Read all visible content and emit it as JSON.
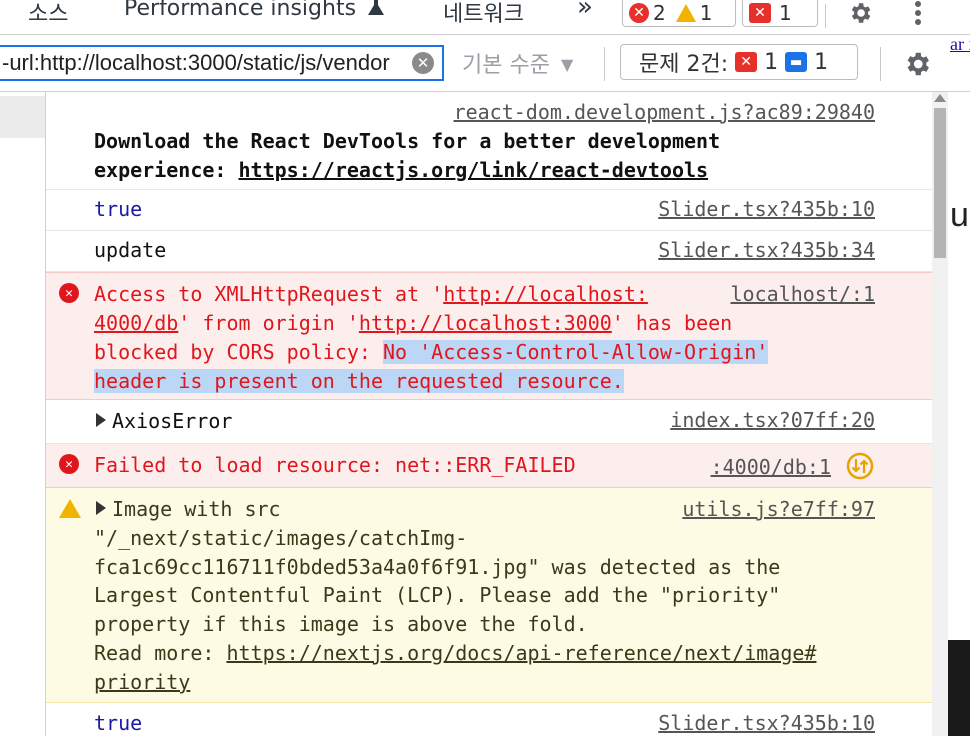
{
  "tabs": {
    "sources": "소스",
    "performance_insights": "Performance insights",
    "network": "네트워크",
    "more": "»"
  },
  "counters": {
    "errors": "2",
    "warnings": "1",
    "issues": "1"
  },
  "toolbar": {
    "filter_value": "-url:http://localhost:3000/static/js/vendor",
    "levels": "기본 수준",
    "issues_label": "문제 2건:",
    "issues_errors": "1",
    "issues_messages": "1"
  },
  "right_edge": {
    "link_fragment": "ar i",
    "letter": "u"
  },
  "console": {
    "msg1": {
      "source": "react-dom.development.js?ac89:29840",
      "line1": "Download the React DevTools for a better development",
      "line2_prefix": "experience: ",
      "line2_link": "https://reactjs.org/link/react-devtools"
    },
    "msg2": {
      "text": "true",
      "source": "Slider.tsx?435b:10"
    },
    "msg3": {
      "text": "update",
      "source": "Slider.tsx?435b:34"
    },
    "msg4": {
      "source": "localhost/:1",
      "l1_pre": "Access to XMLHttpRequest at '",
      "l1_link": "http://localhost:",
      "l2_link": "4000/db",
      "l2_mid": "' from origin '",
      "l2_link2": "http://localhost:3000",
      "l2_post": "' has been",
      "l3_pre": "blocked by CORS policy: ",
      "l3_hl": "No 'Access-Control-Allow-Origin'",
      "l4_hl": "header is present on the requested resource."
    },
    "msg5": {
      "text": "AxiosError",
      "source": "index.tsx?07ff:20"
    },
    "msg6": {
      "text": "Failed to load resource: net::ERR_FAILED",
      "source": ":4000/db:1"
    },
    "msg7": {
      "source": "utils.js?e7ff:97",
      "l1": "Image with src",
      "l2": "\"/_next/static/images/catchImg-",
      "l3": "fca1c69cc116711f0bded53a4a0f6f91.jpg\" was detected as the",
      "l4": "Largest Contentful Paint (LCP). Please add the \"priority\"",
      "l5": "property if this image is above the fold.",
      "l6_pre": "Read more: ",
      "l6_link": "https://nextjs.org/docs/api-reference/next/image#",
      "l7_link": "priority"
    },
    "msg8": {
      "text": "true",
      "source": "Slider.tsx?435b:10"
    }
  },
  "colors": {
    "error_text": "#e0161c",
    "error_bg": "#fdeeee",
    "warning_bg": "#fefbe4",
    "highlight": "#bcd6f6",
    "focus_border": "#1a73e8"
  }
}
